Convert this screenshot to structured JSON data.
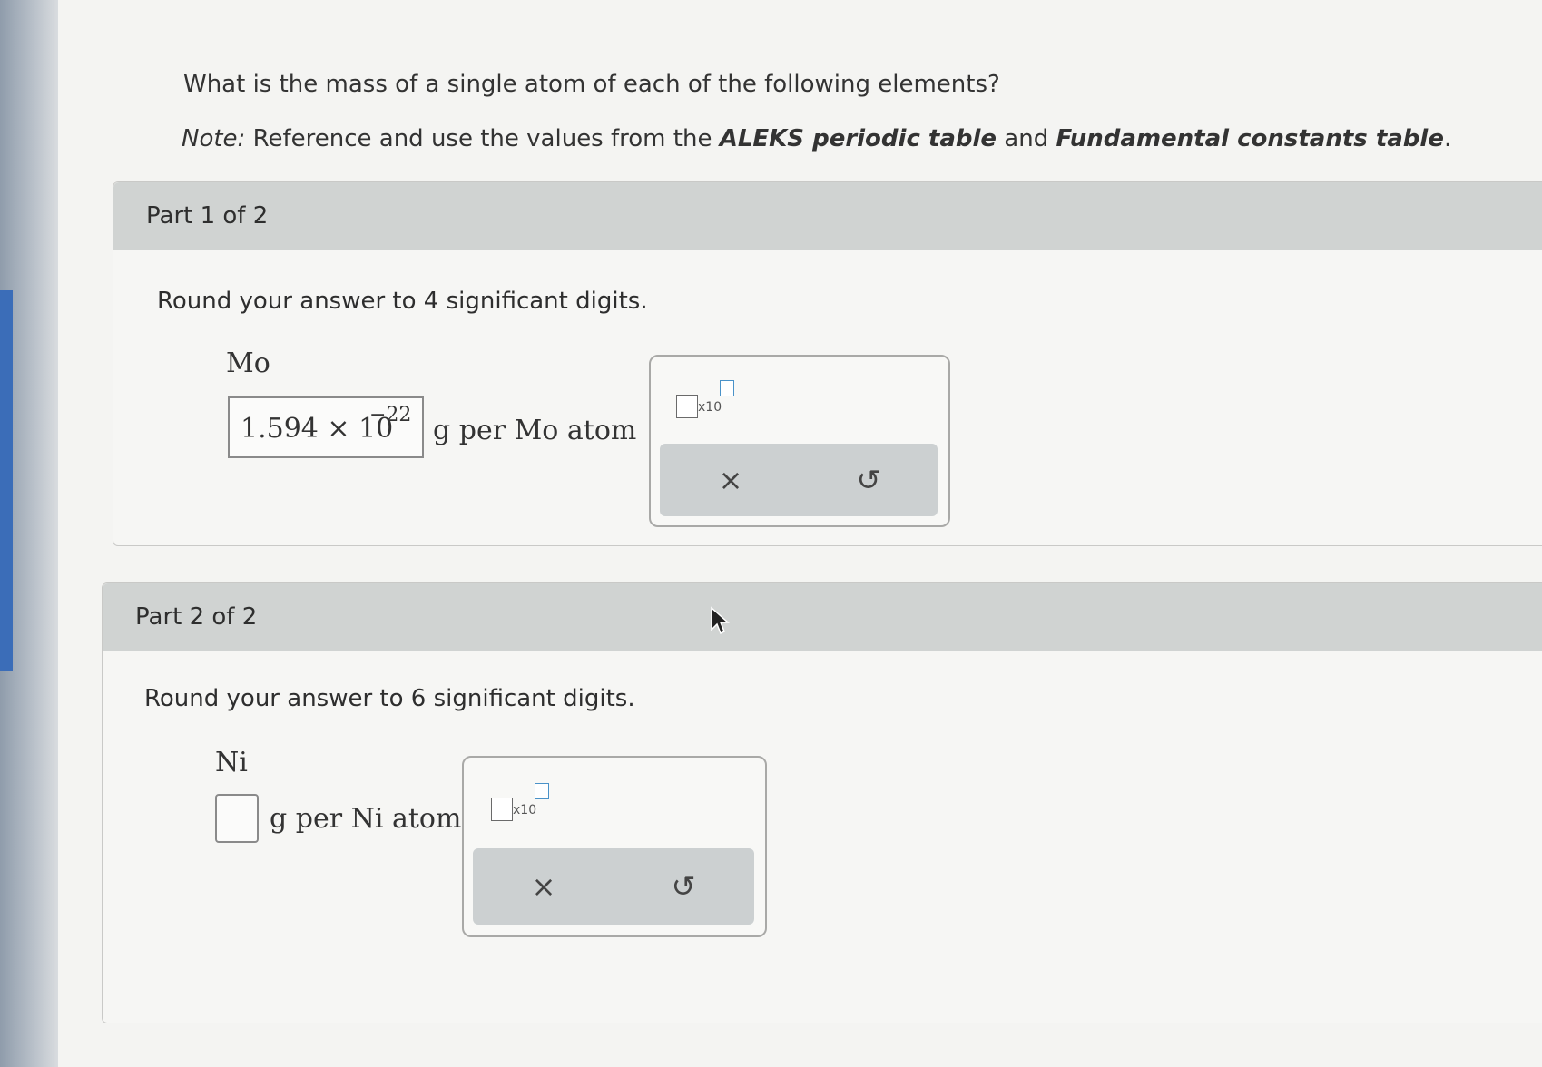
{
  "prompt": {
    "question": "What is the mass of a single atom of each of the following elements?",
    "note_label": "Note:",
    "note_text_1": " Reference and use the values from the ",
    "note_bold_1": "ALEKS periodic table",
    "note_text_2": " and ",
    "note_bold_2": "Fundamental constants table",
    "note_end": "."
  },
  "part1": {
    "title": "Part 1 of 2",
    "instruction": "Round your answer to 4 significant digits.",
    "element": "Mo",
    "answer_mantissa": "1.594 × 10",
    "answer_exponent": "−22",
    "unit": "g per Mo atom",
    "sci_label": "x10",
    "clear_icon": "×",
    "undo_icon": "↺"
  },
  "part2": {
    "title": "Part 2 of 2",
    "instruction": "Round your answer to 6 significant digits.",
    "element": "Ni",
    "answer_value": "",
    "unit": "g per Ni atom",
    "sci_label": "x10",
    "clear_icon": "×",
    "undo_icon": "↺"
  },
  "colors": {
    "header_bg": "#d0d3d2",
    "action_bar_bg": "#ccd0d1",
    "superscript_box": "#4a92c8"
  }
}
